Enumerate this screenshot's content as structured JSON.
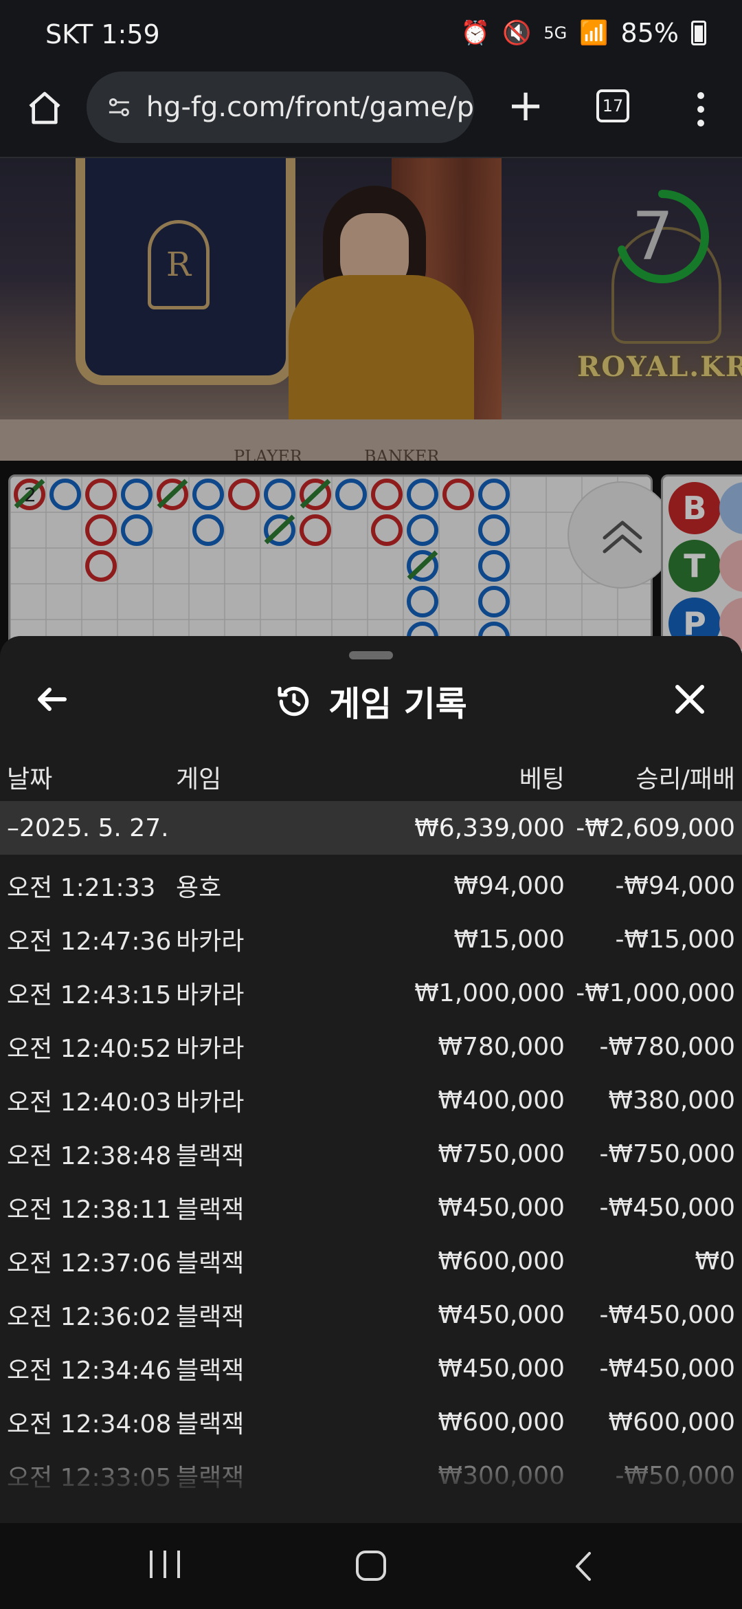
{
  "status_bar": {
    "carrier_time": "SKT 1:59",
    "icons": [
      "alarm-icon",
      "mute-icon",
      "5g-data-icon",
      "signal-icon"
    ],
    "battery": "85%"
  },
  "browser": {
    "url": "hg-fg.com/front/game/p",
    "tab_count": "17"
  },
  "video": {
    "timer_value": "7",
    "timer_fraction": 0.7,
    "brand": "ROYAL.KR",
    "table_player": "PLAYER",
    "table_banker": "BANKER",
    "crest_letter": "R"
  },
  "roadmap": {
    "first_cell_label": "2",
    "side_bets": [
      {
        "label": "B",
        "color": "#c62828"
      },
      {
        "label": "T",
        "color": "#2e7d32"
      },
      {
        "label": "P",
        "color": "#1565c0"
      }
    ]
  },
  "history": {
    "title": "게임 기록",
    "columns": {
      "date": "날짜",
      "game": "게임",
      "bet": "베팅",
      "result": "승리/패배"
    },
    "group": {
      "date": "–2025. 5. 27.",
      "bet": "₩6,339,000",
      "result": "-₩2,609,000"
    },
    "rows": [
      {
        "time": "오전 1:21:33",
        "game": "용호",
        "bet": "₩94,000",
        "result": "-₩94,000"
      },
      {
        "time": "오전 12:47:36",
        "game": "바카라",
        "bet": "₩15,000",
        "result": "-₩15,000"
      },
      {
        "time": "오전 12:43:15",
        "game": "바카라",
        "bet": "₩1,000,000",
        "result": "-₩1,000,000"
      },
      {
        "time": "오전 12:40:52",
        "game": "바카라",
        "bet": "₩780,000",
        "result": "-₩780,000"
      },
      {
        "time": "오전 12:40:03",
        "game": "바카라",
        "bet": "₩400,000",
        "result": "₩380,000"
      },
      {
        "time": "오전 12:38:48",
        "game": "블랙잭",
        "bet": "₩750,000",
        "result": "-₩750,000"
      },
      {
        "time": "오전 12:38:11",
        "game": "블랙잭",
        "bet": "₩450,000",
        "result": "-₩450,000"
      },
      {
        "time": "오전 12:37:06",
        "game": "블랙잭",
        "bet": "₩600,000",
        "result": "₩0"
      },
      {
        "time": "오전 12:36:02",
        "game": "블랙잭",
        "bet": "₩450,000",
        "result": "-₩450,000"
      },
      {
        "time": "오전 12:34:46",
        "game": "블랙잭",
        "bet": "₩450,000",
        "result": "-₩450,000"
      },
      {
        "time": "오전 12:34:08",
        "game": "블랙잭",
        "bet": "₩600,000",
        "result": "₩600,000"
      },
      {
        "time": "오전 12:33:05",
        "game": "블랙잭",
        "bet": "₩300,000",
        "result": "-₩50,000"
      }
    ]
  },
  "colors": {
    "banker": "#c62828",
    "player": "#1565c0",
    "tie": "#2e7d32",
    "timer": "#1fa83a"
  }
}
